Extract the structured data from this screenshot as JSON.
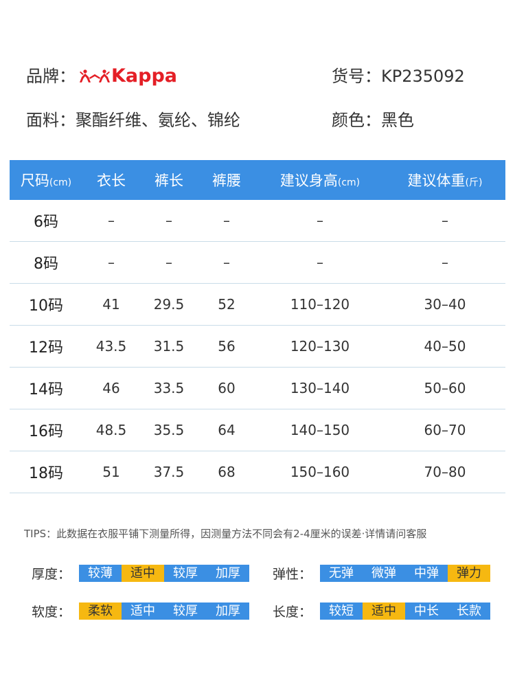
{
  "product": {
    "brand_label": "品牌：",
    "brand_name": "Kappa",
    "item_no_label": "货号：",
    "item_no": "KP235092",
    "fabric_label": "面料：",
    "fabric": "聚酯纤维、氨纶、锦纶",
    "color_label": "颜色：",
    "color": "黑色"
  },
  "colors": {
    "header_blue": "#3b8fe3",
    "highlight_yellow": "#f6b811",
    "logo_red": "#e41f26"
  },
  "size_table": {
    "headers": [
      {
        "label": "尺码",
        "unit": "(cm)"
      },
      {
        "label": "衣长",
        "unit": ""
      },
      {
        "label": "裤长",
        "unit": ""
      },
      {
        "label": "裤腰",
        "unit": ""
      },
      {
        "label": "建议身高",
        "unit": "(cm)"
      },
      {
        "label": "建议体重",
        "unit": "(斤)"
      }
    ],
    "rows": [
      [
        "6码",
        "–",
        "–",
        "–",
        "–",
        "–"
      ],
      [
        "8码",
        "–",
        "–",
        "–",
        "–",
        "–"
      ],
      [
        "10码",
        "41",
        "29.5",
        "52",
        "110–120",
        "30–40"
      ],
      [
        "12码",
        "43.5",
        "31.5",
        "56",
        "120–130",
        "40–50"
      ],
      [
        "14码",
        "46",
        "33.5",
        "60",
        "130–140",
        "50–60"
      ],
      [
        "16码",
        "48.5",
        "35.5",
        "64",
        "140–150",
        "60–70"
      ],
      [
        "18码",
        "51",
        "37.5",
        "68",
        "150–160",
        "70–80"
      ]
    ]
  },
  "tips": "TIPS：此数据在衣服平铺下测量所得，因测量方法不同会有2-4厘米的误差·详情请问客服",
  "attributes": {
    "thickness": {
      "label": "厚度：",
      "options": [
        "较薄",
        "适中",
        "较厚",
        "加厚"
      ],
      "selected": 1
    },
    "elasticity": {
      "label": "弹性：",
      "options": [
        "无弹",
        "微弹",
        "中弹",
        "弹力"
      ],
      "selected": 3
    },
    "softness": {
      "label": "软度：",
      "options": [
        "柔软",
        "适中",
        "较厚",
        "加厚"
      ],
      "selected": 0
    },
    "length": {
      "label": "长度：",
      "options": [
        "较短",
        "适中",
        "中长",
        "长款"
      ],
      "selected": 1
    }
  }
}
